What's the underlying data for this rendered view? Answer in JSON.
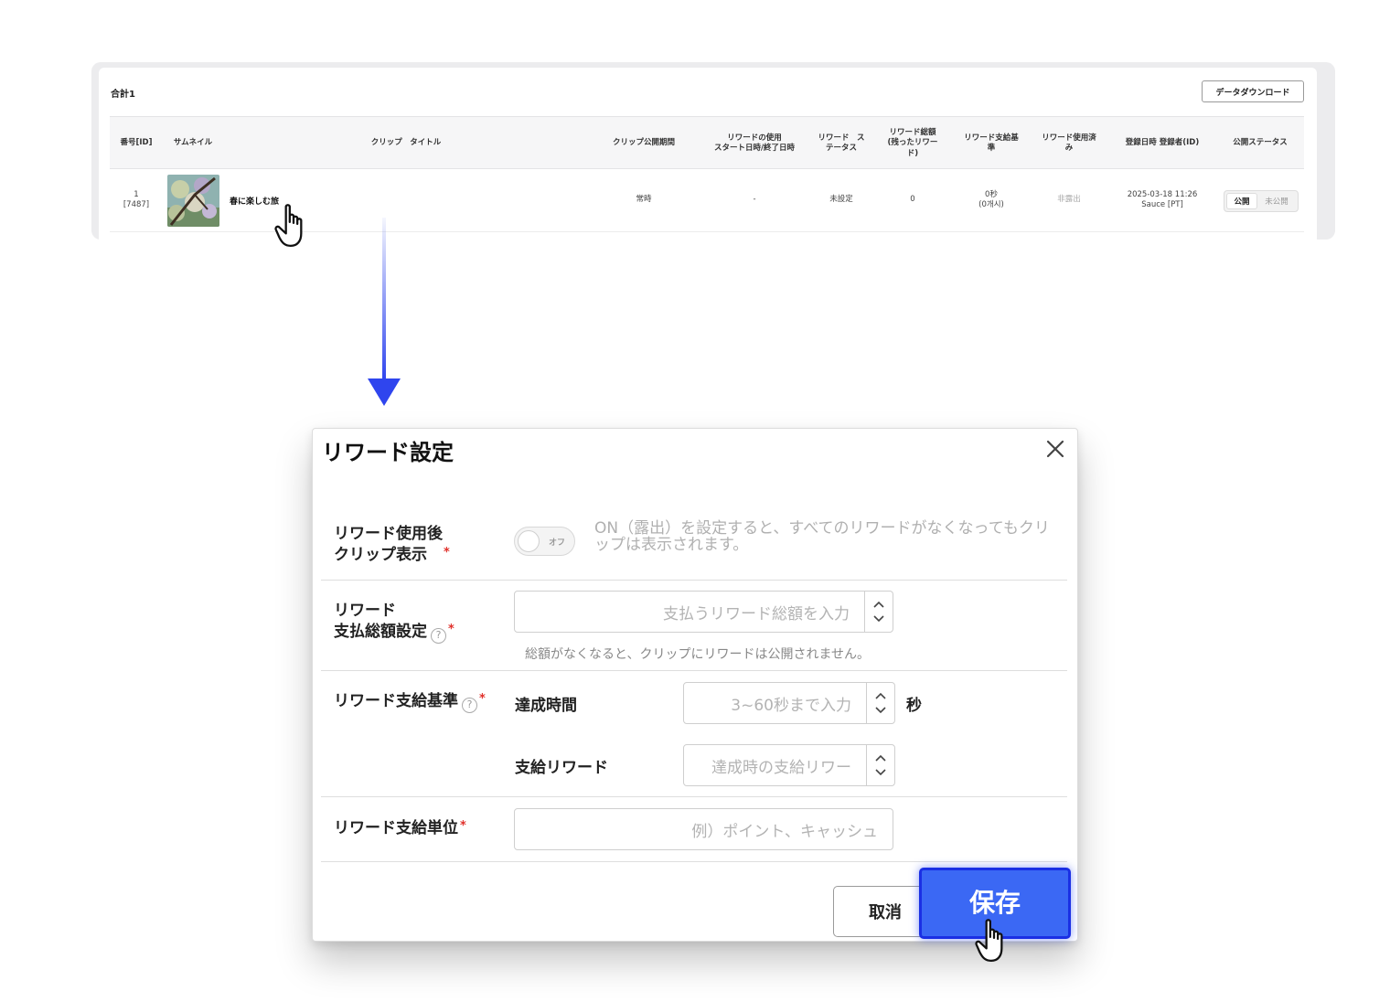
{
  "table": {
    "total_label": "合計1",
    "download_button": "データダウンロード",
    "headers": {
      "id": "番号[ID]",
      "thumbnail": "サムネイル",
      "title": "クリップ　タイトル",
      "period": "クリップ公開期間",
      "reward_start_line1": "リワードの使用",
      "reward_start_line2": "スタート日時/終了日時",
      "reward_status_line1": "リワード　ス",
      "reward_status_line2": "テータス",
      "reward_total_line1": "リワード総額",
      "reward_total_line2": "(残ったリワー",
      "reward_total_line3": "ド)",
      "reward_criteria_line1": "リワード支給基",
      "reward_criteria_line2": "準",
      "reward_used_line1": "リワード使用済",
      "reward_used_line2": "み",
      "registered": "登録日時 登録者(ID)",
      "public_status": "公開ステータス"
    },
    "rows": [
      {
        "number": "1",
        "id": "[7487]",
        "title": "春に楽しむ旅",
        "period": "常時",
        "reward_start": "-",
        "reward_status": "未設定",
        "reward_total": "0",
        "criteria_time": "0秒",
        "criteria_count": "(0개시)",
        "used": "非露出",
        "date": "2025-03-18 11:26",
        "registrant": "Sauce [PT]",
        "status_on": "公開",
        "status_off": "未公開"
      }
    ]
  },
  "modal": {
    "title": "リワード設定",
    "fields": {
      "display_after_label_line1": "リワード使用後",
      "display_after_label_line2": "クリップ表示",
      "toggle_label": "オフ",
      "display_after_hint": "ON（露出）を設定すると、すべてのリワードがなくなってもクリップは表示されます。",
      "total_label_line1": "リワード",
      "total_label_line2": "支払総額設定",
      "total_placeholder": "支払うリワード総額を入力",
      "total_note": "総額がなくなると、クリップにリワードは公開されません。",
      "criteria_label": "リワード支給基準",
      "achieve_time_label": "達成時間",
      "achieve_time_placeholder": "3~60秒まで入力",
      "achieve_time_unit": "秒",
      "payout_label": "支給リワード",
      "payout_placeholder": "達成時の支給リワー",
      "unit_label": "リワード支給単位",
      "unit_placeholder": "例）ポイント、キャッシュ"
    },
    "cancel_button": "取消",
    "save_button": "保存"
  },
  "colors": {
    "accent": "#3b68f4",
    "accent_border": "#1a2fe4",
    "arrow": "#2f45ee",
    "required": "#e0302a"
  }
}
